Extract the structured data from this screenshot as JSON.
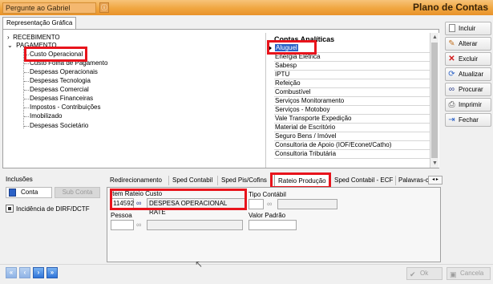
{
  "titlebar": {
    "ask_placeholder": "Pergunte ao Gabriel",
    "ask_button": "ⓘ",
    "window_title": "Plano de Contas"
  },
  "top_tab": {
    "label": "Representação Gráfica"
  },
  "tree": {
    "roots": [
      "RECEBIMENTO",
      "PAGAMENTO"
    ],
    "children": [
      "Custo Operacional",
      "Custo Folha de Pagamento",
      "Despesas Operacionais",
      "Despesas Tecnologia",
      "Despesas Comercial",
      "Despesas Financeiras",
      "Impostos - Contribuições",
      "Imobilizado",
      "Despesas Societário"
    ],
    "highlighted": "Custo Operacional"
  },
  "accounts": {
    "header": "Contas Analíticas",
    "selected": "Aluguel",
    "items": [
      "Aluguel",
      "Energia Elétrica",
      "Sabesp",
      "IPTU",
      "Refeição",
      "Combustível",
      "Serviços Monitoramento",
      "Serviços - Motoboy",
      "Vale Transporte Expedição",
      "Material de Escritório",
      "Seguro Bens / Imóvel",
      "Consultoria de Apoio (IOF/Econet/Catho)",
      "Consultoria Tributária"
    ]
  },
  "sidebar": {
    "incluir": "Incluir",
    "alterar": "Alterar",
    "excluir": "Excluir",
    "atualizar": "Atualizar",
    "procurar": "Procurar",
    "imprimir": "Imprimir",
    "fechar": "Fechar"
  },
  "inclusions": {
    "label": "Inclusões",
    "conta_button": "Conta",
    "cuta_button": "Sub Conta",
    "dirf_label": "Incidência de DIRF/DCTF"
  },
  "subtabs": {
    "items": [
      "Redirecionamento",
      "Sped Contabil",
      "Sped Pis/Cofins",
      "Rateio Produção",
      "Sped Contabil - ECF",
      "Palavras-c"
    ],
    "selected": "Rateio Produção"
  },
  "rateio": {
    "item_label": "Item Rateio Custo",
    "item_code": "114592",
    "item_desc": "DESPESA OPERACIONAL RATE",
    "tipo_label": "Tipo Contábil",
    "pessoa_label": "Pessoa",
    "valor_label": "Valor Padrão"
  },
  "footer": {
    "ok": "Ok",
    "cancel": "Cancela"
  }
}
